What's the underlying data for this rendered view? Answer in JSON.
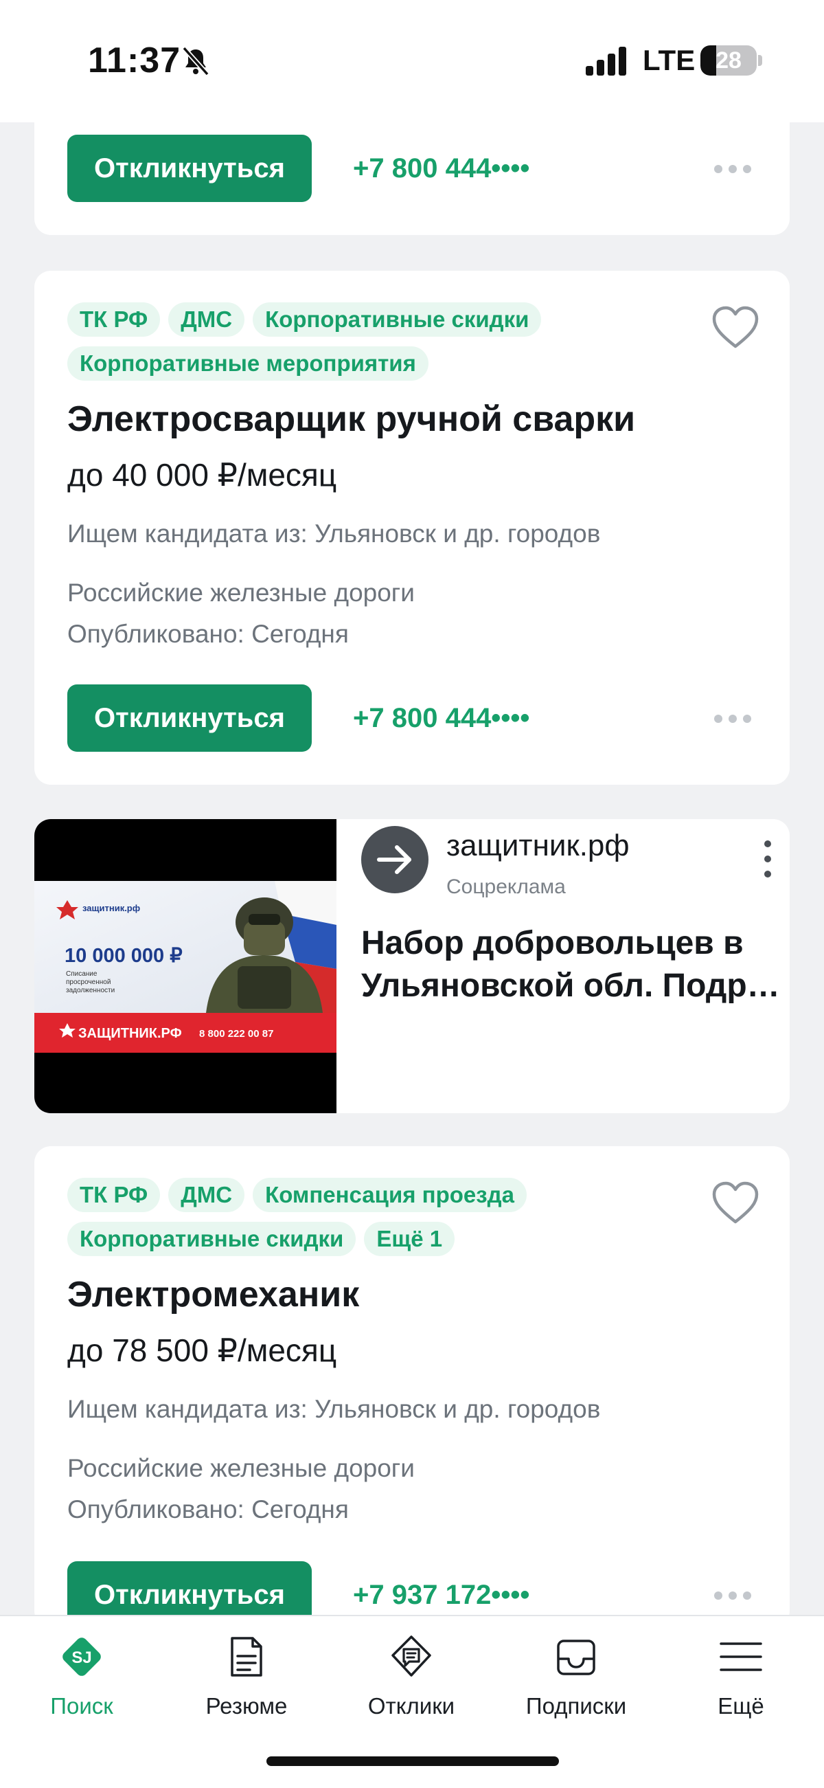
{
  "status_bar": {
    "time": "11:37",
    "network": "LTE",
    "battery": "28",
    "battery_level": 0.28
  },
  "vacancies": [
    {
      "respond_label": "Откликнуться",
      "phone": "+7 800 444••••"
    },
    {
      "tags": [
        "ТК РФ",
        "ДМС",
        "Корпоративные скидки",
        "Корпоративные мероприятия"
      ],
      "title": "Электросварщик ручной сварки",
      "salary": "до 40 000 ₽/месяц",
      "location": "Ищем кандидата из: Ульяновск и др. городов",
      "company": "Российские железные дороги",
      "published": "Опубликовано: Сегодня",
      "respond_label": "Откликнуться",
      "phone": "+7 800 444••••"
    },
    {
      "tags": [
        "ТК РФ",
        "ДМС",
        "Компенсация проезда",
        "Корпоративные скидки",
        "Ещё 1"
      ],
      "title": "Электромеханик",
      "salary": "до 78 500 ₽/месяц",
      "location": "Ищем кандидата из: Ульяновск и др. городов",
      "company": "Российские железные дороги",
      "published": "Опубликовано: Сегодня",
      "respond_label": "Откликнуться",
      "phone": "+7 937 172••••"
    }
  ],
  "ad": {
    "site": "защитник.рф",
    "label": "Соцреклама",
    "title_line1": "Набор добровольцев в",
    "title_line2": "Ульяновской обл. Подробнее",
    "banner": {
      "logo": "защитник.рф",
      "amount": "10 000 000 ₽",
      "caption_1": "Списание",
      "caption_2": "просроченной",
      "caption_3": "задолженности",
      "footer_site": "ЗАЩИТНИК.РФ",
      "footer_phone": "8 800 222 00 87"
    }
  },
  "bottom_nav": [
    {
      "label": "Поиск",
      "icon": "sj-logo-icon",
      "active": true
    },
    {
      "label": "Резюме",
      "icon": "resume-icon",
      "active": false
    },
    {
      "label": "Отклики",
      "icon": "responses-icon",
      "active": false
    },
    {
      "label": "Подписки",
      "icon": "inbox-icon",
      "active": false
    },
    {
      "label": "Ещё",
      "icon": "menu-icon",
      "active": false
    }
  ],
  "colors": {
    "accent": "#148f62",
    "accent_text": "#17a06a",
    "tag_bg": "#e8f7f0",
    "background": "#f0f1f3"
  }
}
